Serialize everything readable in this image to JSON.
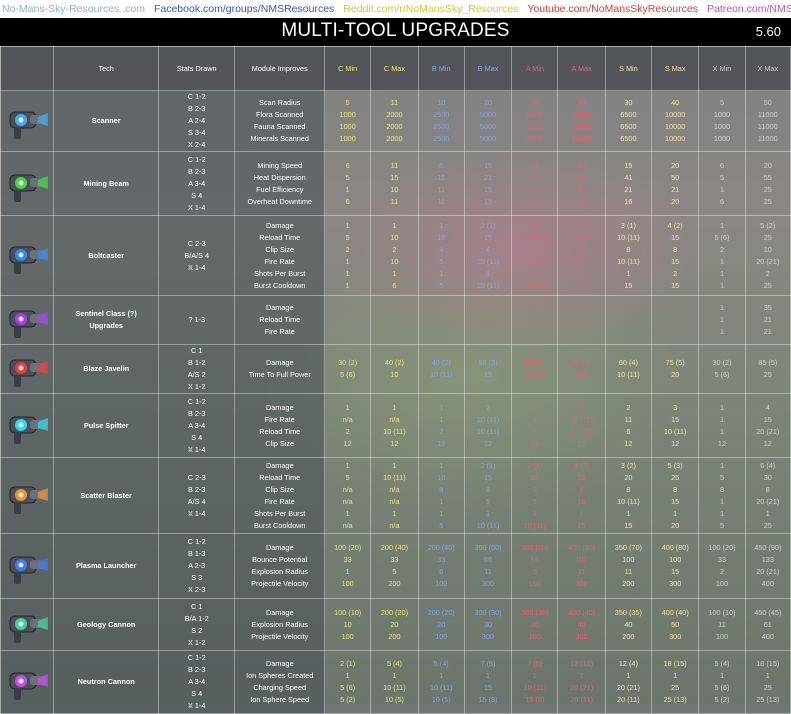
{
  "topbar": [
    {
      "text": "No-Mans-Sky-Resources .com",
      "color": "#8ab0d8"
    },
    {
      "text": "Facebook.com/groups/NMSResources",
      "color": "#2f55d6"
    },
    {
      "text": "Reddit.com/r/NoMansSky_Resources",
      "color": "#e3c12d"
    },
    {
      "text": "Youtube.com/NoMansSkyResources",
      "color": "#e23b2b"
    },
    {
      "text": "Patreon.com/NMSResources",
      "color": "#c24ec4"
    }
  ],
  "title": "MULTI-TOOL UPGRADES",
  "version": "5.60",
  "headers": [
    "Tech",
    "Stats Drawn",
    "Module Improves",
    "C Min",
    "C Max",
    "B Min",
    "B Max",
    "A Min",
    "A Max",
    "S Min",
    "S Max",
    "X Min",
    "X Max"
  ],
  "rows": [
    {
      "icon": "scanner-icon",
      "accent": "#3fb8ff",
      "tech": [
        "Scanner"
      ],
      "stats": [
        "C 1-2",
        "B 2-3",
        "A 2-4",
        "S 3-4",
        "X 2-4"
      ],
      "improves": [
        "Scan Radius",
        "Flora Scanned",
        "Fauna Scanned",
        "Minerals Scanned"
      ],
      "values": [
        [
          "5",
          "1000",
          "1000",
          "1000"
        ],
        [
          "11",
          "2000",
          "2000",
          "2000"
        ],
        [
          "10",
          "2500",
          "2500",
          "2500"
        ],
        [
          "20",
          "5000",
          "5000",
          "5000"
        ],
        [
          "20",
          "5000",
          "5000",
          "5000"
        ],
        [
          "30",
          "10000",
          "10000",
          "10000"
        ],
        [
          "30",
          "6500",
          "6500",
          "6500"
        ],
        [
          "40",
          "10000",
          "10000",
          "10000"
        ],
        [
          "5",
          "1000",
          "1000",
          "1000"
        ],
        [
          "50",
          "11000",
          "11000",
          "11000"
        ]
      ]
    },
    {
      "icon": "mining-beam-icon",
      "accent": "#44e63c",
      "tech": [
        "Mining Beam"
      ],
      "stats": [
        "C 1-2",
        "B 2-3",
        "A 3-4",
        "S 4",
        "X 1-4"
      ],
      "improves": [
        "Mining Speed",
        "Heat Dispersion",
        "Fuel Efficiency",
        "Overheat Downtime"
      ],
      "values": [
        [
          "6",
          "5",
          "1",
          "6"
        ],
        [
          "11",
          "15",
          "10",
          "11"
        ],
        [
          "6",
          "15",
          "11",
          "11"
        ],
        [
          "15",
          "21",
          "15",
          "15"
        ],
        [
          "11",
          "21",
          "15",
          "11"
        ],
        [
          "20",
          "40",
          "20",
          "15"
        ],
        [
          "15",
          "41",
          "21",
          "16"
        ],
        [
          "20",
          "50",
          "21",
          "20"
        ],
        [
          "6",
          "5",
          "1",
          "6"
        ],
        [
          "20",
          "55",
          "25",
          "25"
        ]
      ]
    },
    {
      "icon": "boltcaster-icon",
      "accent": "#2f8fff",
      "tech": [
        "Boltcaster"
      ],
      "stats": [
        "C 2-3",
        "B/A/S 4",
        "X 1-4"
      ],
      "improves": [
        "Damage",
        "Reload Time",
        "Clip Size",
        "Fire Rate",
        "Shots Per Burst",
        "Burst Cooldown"
      ],
      "values": [
        [
          "1",
          "5",
          "2",
          "1",
          "1",
          "1"
        ],
        [
          "1",
          "10",
          "2",
          "10",
          "1",
          "6"
        ],
        [
          "1",
          "10",
          "4",
          "5",
          "1",
          "5"
        ],
        [
          "2 (1)",
          "15",
          "4",
          "10 (11)",
          "1",
          "10 (11)"
        ],
        [
          "2 (1)",
          "10 (11)",
          "4",
          "10 (11)",
          "1",
          "10 (11)"
        ],
        [
          "3 (1)",
          "20",
          "6",
          "15",
          "2",
          "15"
        ],
        [
          "3 (1)",
          "10 (11)",
          "8",
          "10 (11)",
          "1",
          "15"
        ],
        [
          "4 (2)",
          "15",
          "8",
          "15",
          "2",
          "15"
        ],
        [
          "1",
          "5 (6)",
          "2",
          "1",
          "1",
          "1"
        ],
        [
          "5 (2)",
          "25",
          "10",
          "20 (21)",
          "2",
          "25"
        ]
      ]
    },
    {
      "icon": "sentinel-icon",
      "accent": "#b53cff",
      "tech": [
        "Sentinel Class (?)",
        "Upgrades"
      ],
      "stats": [
        "? 1-3"
      ],
      "improves": [
        "Damage",
        "Reload Time",
        "Fire Rate"
      ],
      "values": [
        [
          "",
          "",
          ""
        ],
        [
          "",
          "",
          ""
        ],
        [
          "",
          "",
          ""
        ],
        [
          "",
          "",
          ""
        ],
        [
          "",
          "",
          ""
        ],
        [
          "",
          "",
          ""
        ],
        [
          "",
          "",
          ""
        ],
        [
          "",
          "",
          ""
        ],
        [
          "1",
          "1",
          "1"
        ],
        [
          "35",
          "21",
          "21"
        ]
      ]
    },
    {
      "icon": "blaze-javelin-icon",
      "accent": "#ff3a3a",
      "tech": [
        "Blaze Javelin"
      ],
      "stats": [
        "C 1",
        "B 1-2",
        "A/S 2",
        "X 1-2"
      ],
      "improves": [
        "Damage",
        "Time To Full Power"
      ],
      "values": [
        [
          "30 (2)",
          "5 (6)"
        ],
        [
          "40 (2)",
          "10"
        ],
        [
          "40 (2)",
          "10 (11)"
        ],
        [
          "50 (3)",
          "15"
        ],
        [
          "50 (3)",
          "10 (11)"
        ],
        [
          "60 (4)",
          "20"
        ],
        [
          "60 (4)",
          "10 (11)"
        ],
        [
          "75 (5)",
          "20"
        ],
        [
          "30 (2)",
          "5 (6)"
        ],
        [
          "85 (5)",
          "25"
        ]
      ]
    },
    {
      "icon": "pulse-spitter-icon",
      "accent": "#2fe7ff",
      "tech": [
        "Pulse Spitter"
      ],
      "stats": [
        "C 1-2",
        "B 2-3",
        "A 3-4",
        "S 4",
        "X 1-4"
      ],
      "improves": [
        "Damage",
        "Fire Rate",
        "Reload Time",
        "Clip Size"
      ],
      "values": [
        [
          "1",
          "n/a",
          "2",
          "12"
        ],
        [
          "1",
          "n/a",
          "10 (11)",
          "12"
        ],
        [
          "1",
          "1",
          "2",
          "12"
        ],
        [
          "2",
          "10 (11)",
          "10 (11)",
          "12"
        ],
        [
          "1",
          "5",
          "5",
          "12"
        ],
        [
          "3",
          "10 (11)",
          "10 (11)",
          "12"
        ],
        [
          "2",
          "11",
          "6",
          "12"
        ],
        [
          "3",
          "15",
          "10 (11)",
          "12"
        ],
        [
          "1",
          "1",
          "1",
          "12"
        ],
        [
          "4",
          "15",
          "20 (21)",
          "12"
        ]
      ]
    },
    {
      "icon": "scatter-blaster-icon",
      "accent": "#ff9a2e",
      "tech": [
        "Scatter Blaster"
      ],
      "stats": [
        "C 2-3",
        "B 2-3",
        "A/S 4",
        "X 1-4"
      ],
      "improves": [
        "Damage",
        "Reload Time",
        "Clip Size",
        "Fire Rate",
        "Shots Per Burst",
        "Burst Cooldown"
      ],
      "values": [
        [
          "1",
          "5",
          "n/a",
          "n/a",
          "1",
          "n/a"
        ],
        [
          "1",
          "10 (11)",
          "n/a",
          "n/a",
          "1",
          "n/a"
        ],
        [
          "1",
          "10",
          "8",
          "1",
          "1",
          "5"
        ],
        [
          "2 (1)",
          "15",
          "8",
          "5",
          "1",
          "10 (11)"
        ],
        [
          "2 (1)",
          "15",
          "8",
          "5",
          "1",
          "10 (11)"
        ],
        [
          "4 (2)",
          "20",
          "8",
          "10",
          "1",
          "15"
        ],
        [
          "3 (2)",
          "20",
          "8",
          "10 (11)",
          "1",
          "15"
        ],
        [
          "5 (3)",
          "25",
          "8",
          "15",
          "1",
          "20"
        ],
        [
          "1",
          "5",
          "8",
          "1",
          "1",
          "5"
        ],
        [
          "6 (4)",
          "30",
          "8",
          "20 (21)",
          "1",
          "25"
        ]
      ]
    },
    {
      "icon": "plasma-launcher-icon",
      "accent": "#3f7cff",
      "tech": [
        "Plasma Launcher"
      ],
      "stats": [
        "C 1-2",
        "B 1-3",
        "A 2-3",
        "S 3",
        "X 2-3"
      ],
      "improves": [
        "Damage",
        "Bounce Potential",
        "Explosion Radius",
        "Projectile Velocity"
      ],
      "values": [
        [
          "100 (20)",
          "33",
          "1",
          "100"
        ],
        [
          "200 (40)",
          "33",
          "5",
          "200"
        ],
        [
          "200 (40)",
          "33",
          "6",
          "100"
        ],
        [
          "300 (60)",
          "66",
          "11",
          "300"
        ],
        [
          "300 (60)",
          "66",
          "6",
          "100"
        ],
        [
          "400 (80)",
          "100",
          "11",
          "300"
        ],
        [
          "350 (70)",
          "100",
          "11",
          "200"
        ],
        [
          "400 (80)",
          "100",
          "15",
          "300"
        ],
        [
          "100 (20)",
          "33",
          "2",
          "100"
        ],
        [
          "450 (90)",
          "133",
          "20 (21)",
          "400"
        ]
      ]
    },
    {
      "icon": "geology-cannon-icon",
      "accent": "#3fe0a0",
      "tech": [
        "Geology Cannon"
      ],
      "stats": [
        "C 1",
        "B/A 1-2",
        "S 2",
        "X 1-2"
      ],
      "improves": [
        "Damage",
        "Explosion Radius",
        "Projectile Velocity"
      ],
      "values": [
        [
          "100 (10)",
          "10",
          "100"
        ],
        [
          "200 (20)",
          "20",
          "200"
        ],
        [
          "200 (20)",
          "20",
          "100"
        ],
        [
          "300 (30)",
          "30",
          "300"
        ],
        [
          "300 (30)",
          "30",
          "100"
        ],
        [
          "400 (40)",
          "40",
          "300"
        ],
        [
          "350 (35)",
          "40",
          "200"
        ],
        [
          "400 (40)",
          "50",
          "300"
        ],
        [
          "100 (10)",
          "11",
          "100"
        ],
        [
          "450 (45)",
          "61",
          "400"
        ]
      ]
    },
    {
      "icon": "neutron-cannon-icon",
      "accent": "#d14cff",
      "tech": [
        "Neutron Cannon"
      ],
      "stats": [
        "C 1-2",
        "B 2-3",
        "A 3-4",
        "S 4",
        "X 1-4"
      ],
      "improves": [
        "Damage",
        "Ion Spheres Created",
        "Charging Speed",
        "Ion Sphere Speed"
      ],
      "values": [
        [
          "2 (1)",
          "1",
          "5 (6)",
          "5 (2)"
        ],
        [
          "5 (4)",
          "1",
          "10 (11)",
          "10 (5)"
        ],
        [
          "5 (4)",
          "1",
          "10 (11)",
          "10 (5)"
        ],
        [
          "7 (5)",
          "1",
          "15",
          "15 (8)"
        ],
        [
          "7 (5)",
          "1",
          "10 (11)",
          "15 (8)"
        ],
        [
          "12 (10)",
          "1",
          "20 (21)",
          "20 (11)"
        ],
        [
          "12 (4)",
          "1",
          "20 (21)",
          "20 (11)"
        ],
        [
          "18 (15)",
          "1",
          "25",
          "25 (13)"
        ],
        [
          "5 (4)",
          "1",
          "5 (6)",
          "5 (2)"
        ],
        [
          "18 (15)",
          "1",
          "25",
          "25 (13)"
        ]
      ]
    }
  ]
}
